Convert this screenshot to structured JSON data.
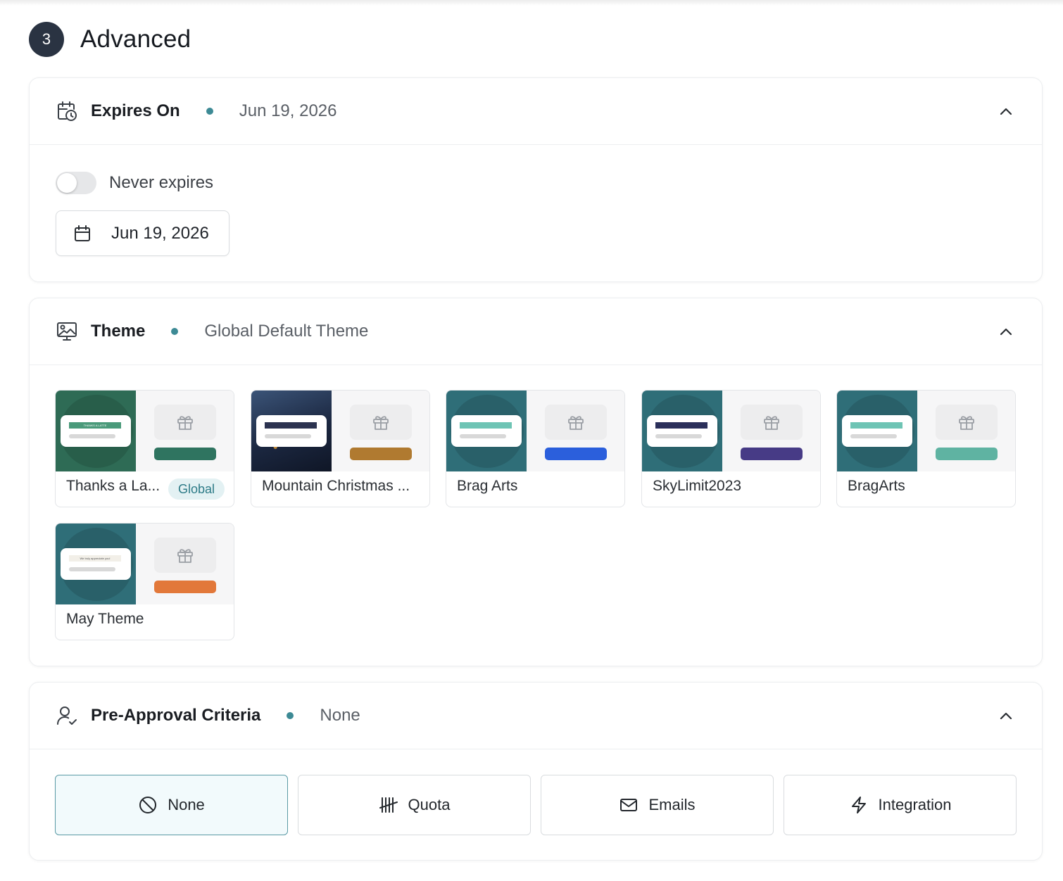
{
  "section": {
    "step": "3",
    "title": "Advanced"
  },
  "expires": {
    "title": "Expires On",
    "value": "Jun 19, 2026",
    "toggle_label": "Never expires",
    "toggle_on": false,
    "date_value": "Jun 19, 2026"
  },
  "theme": {
    "title": "Theme",
    "value": "Global Default Theme",
    "items": [
      {
        "name": "Thanks a La...",
        "badge": "Global",
        "left_color": "#2e6b55",
        "bar_color": "#2f7460",
        "banner_color": "#4a9a7a",
        "banner_text": "THANKS A LATTE"
      },
      {
        "name": "Mountain Christmas ...",
        "badge": "",
        "left_color": "#1d2b44",
        "bar_color": "#b07a30",
        "banner_color": "#2c3350",
        "banner_text": ""
      },
      {
        "name": "Brag Arts",
        "badge": "",
        "left_color": "#2f6e78",
        "bar_color": "#2b5fdc",
        "banner_color": "#6ec4b4",
        "banner_text": ""
      },
      {
        "name": "SkyLimit2023",
        "badge": "",
        "left_color": "#2f6e78",
        "bar_color": "#473b86",
        "banner_color": "#2b2f5a",
        "banner_text": ""
      },
      {
        "name": "BragArts",
        "badge": "",
        "left_color": "#2f6e78",
        "bar_color": "#5fb3a2",
        "banner_color": "#6ec4b4",
        "banner_text": ""
      },
      {
        "name": "May Theme",
        "badge": "",
        "left_color": "#2f6e78",
        "bar_color": "#e2783a",
        "banner_color": "#f2efe8",
        "banner_text": "We truly appreciate you!"
      }
    ]
  },
  "preapproval": {
    "title": "Pre-Approval Criteria",
    "value": "None",
    "options": [
      {
        "label": "None",
        "icon": "ban-icon",
        "selected": true
      },
      {
        "label": "Quota",
        "icon": "tally-icon",
        "selected": false
      },
      {
        "label": "Emails",
        "icon": "mail-icon",
        "selected": false
      },
      {
        "label": "Integration",
        "icon": "lightning-icon",
        "selected": false
      }
    ]
  },
  "colors": {
    "accent": "#3d8a95",
    "badge_bg": "#2a3342",
    "selected_bg": "#f2fafc"
  }
}
